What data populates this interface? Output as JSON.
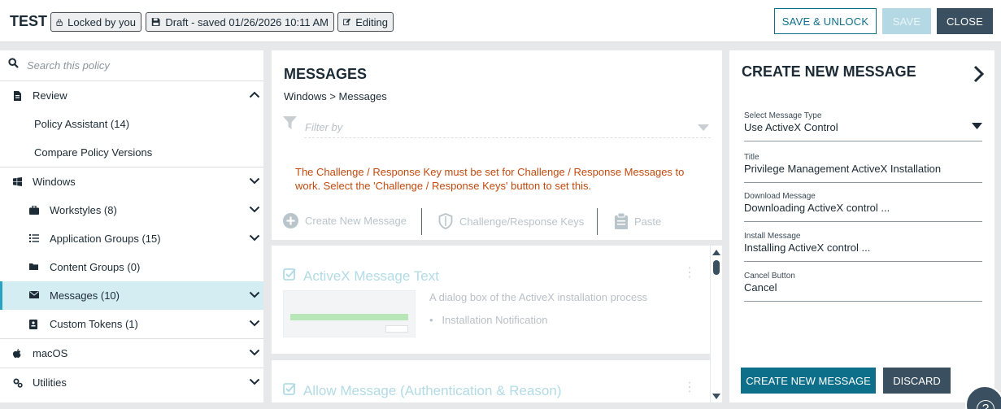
{
  "header": {
    "title": "TEST",
    "lock_label": "Locked by you",
    "draft_label": "Draft - saved 01/26/2026 10:11 AM",
    "editing_label": "Editing",
    "save_unlock_label": "SAVE & UNLOCK",
    "save_label": "SAVE",
    "close_label": "CLOSE"
  },
  "sidebar": {
    "search_placeholder": "Search this policy",
    "review": "Review",
    "policy_assistant": "Policy Assistant (14)",
    "compare_versions": "Compare Policy Versions",
    "windows": "Windows",
    "workstyles": "Workstyles (8)",
    "application_groups": "Application Groups (15)",
    "content_groups": "Content Groups (0)",
    "messages": "Messages (10)",
    "custom_tokens": "Custom Tokens (1)",
    "macos": "macOS",
    "utilities": "Utilities"
  },
  "main": {
    "title": "MESSAGES",
    "breadcrumb": "Windows > Messages",
    "filter_placeholder": "Filter by",
    "warning": "The Challenge / Response Key must be set for Challenge / Response Messages to work. Select the 'Challenge / Response Keys' button to set this.",
    "create_new_message": "Create New Message",
    "challenge_keys": "Challenge/Response Keys",
    "paste": "Paste",
    "cards": [
      {
        "title": "ActiveX Message Text",
        "description": "A dialog box of the ActiveX installation process",
        "bullet": "Installation Notification"
      },
      {
        "title": "Allow Message (Authentication & Reason)"
      }
    ]
  },
  "panel": {
    "title": "CREATE NEW MESSAGE",
    "fields": [
      {
        "label": "Select Message Type",
        "value": "Use ActiveX Control"
      },
      {
        "label": "Title",
        "value": "Privilege Management ActiveX Installation"
      },
      {
        "label": "Download Message",
        "value": "Downloading ActiveX control ..."
      },
      {
        "label": "Install Message",
        "value": "Installing ActiveX control ..."
      },
      {
        "label": "Cancel Button",
        "value": "Cancel"
      }
    ],
    "create_button": "CREATE NEW MESSAGE",
    "discard_button": "DISCARD"
  },
  "help_glyph": "?",
  "colors": {
    "accent": "#0e6f8a",
    "active_bg": "#d3edf3",
    "warning": "#c24a0f",
    "dark_button": "#3a4f5f"
  }
}
